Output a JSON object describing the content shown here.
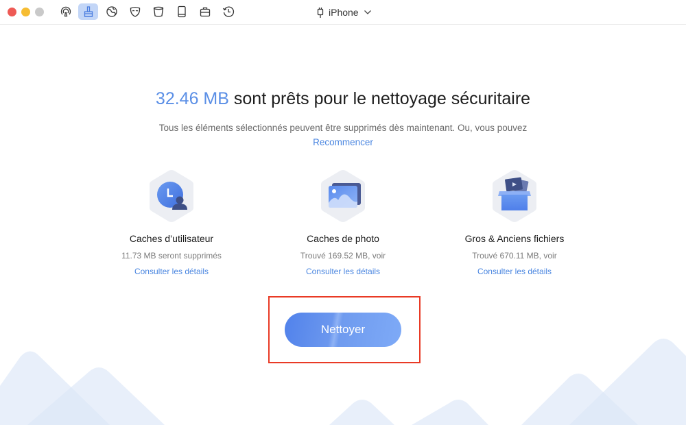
{
  "window": {
    "traffic_lights": [
      "close",
      "minimize",
      "maximize"
    ]
  },
  "toolbar": {
    "icons": [
      {
        "name": "airbackup-icon",
        "label": "AirBackup",
        "active": false
      },
      {
        "name": "cleaner-brush-icon",
        "label": "Cleaner",
        "active": true
      },
      {
        "name": "globe-icon",
        "label": "Globe",
        "active": false
      },
      {
        "name": "mask-icon",
        "label": "Privacy",
        "active": false
      },
      {
        "name": "bucket-icon",
        "label": "Bucket",
        "active": false
      },
      {
        "name": "tablet-icon",
        "label": "Device",
        "active": false
      },
      {
        "name": "briefcase-icon",
        "label": "Toolkit",
        "active": false
      },
      {
        "name": "history-icon",
        "label": "History",
        "active": false
      }
    ],
    "device_name": "iPhone"
  },
  "main": {
    "headline_size": "32.46 MB",
    "headline_text": " sont prêts pour le nettoyage sécuritaire",
    "subline": "Tous les éléments sélectionnés peuvent être supprimés dès maintenant. Ou, vous pouvez",
    "restart_link": "Recommencer",
    "cards": [
      {
        "icon": "user-cache-icon",
        "title": "Caches d’utilisateur",
        "desc": "11.73 MB seront supprimés",
        "link": "Consulter les détails"
      },
      {
        "icon": "photo-cache-icon",
        "title": "Caches de photo",
        "desc": "Trouvé 169.52 MB, voir",
        "link": "Consulter les détails"
      },
      {
        "icon": "large-files-icon",
        "title": "Gros & Anciens fichiers",
        "desc": "Trouvé 670.11 MB, voir",
        "link": "Consulter les détails"
      }
    ],
    "clean_button": "Nettoyer"
  },
  "colors": {
    "accent": "#5b8fe6",
    "link": "#4a86e0",
    "highlight_border": "#e93a25",
    "active_tab_bg": "#c3d6f7"
  }
}
